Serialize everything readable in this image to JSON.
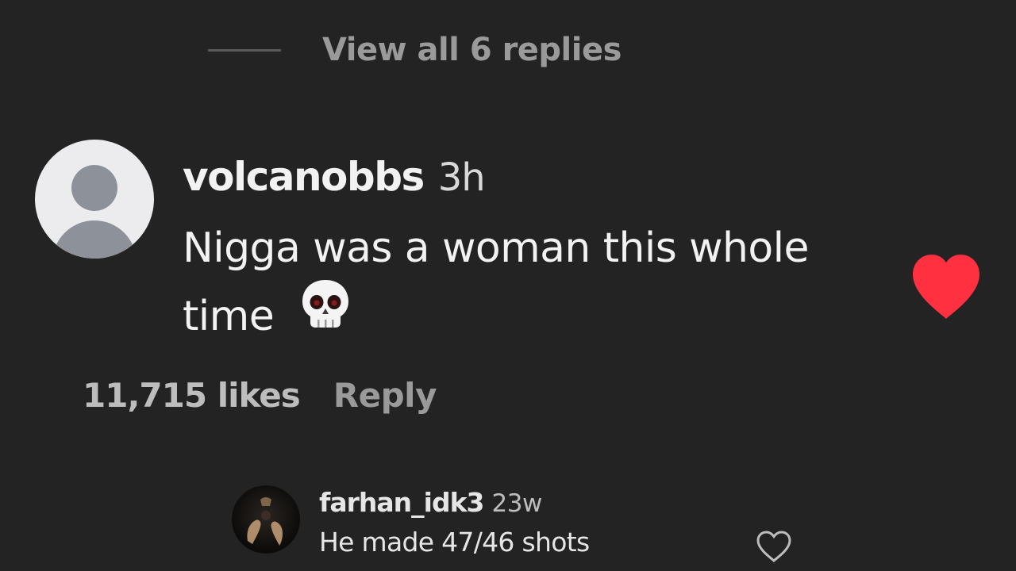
{
  "thread": {
    "view_replies_label": "View all 6 replies"
  },
  "comment": {
    "username": "volcanobbs",
    "time": "3h",
    "text": "Nigga was a woman this whole time",
    "emoji_icon": "skull-icon",
    "likes_label": "11,715 likes",
    "reply_label": "Reply",
    "liked": true,
    "heart_color": "#ff3040"
  },
  "reply": {
    "username": "farhan_idk3",
    "time": "23w",
    "text": "He made 47/46 shots",
    "liked": false
  },
  "colors": {
    "background": "#232323",
    "text_primary": "#f2f2f2",
    "text_secondary": "#9a9a9a"
  }
}
